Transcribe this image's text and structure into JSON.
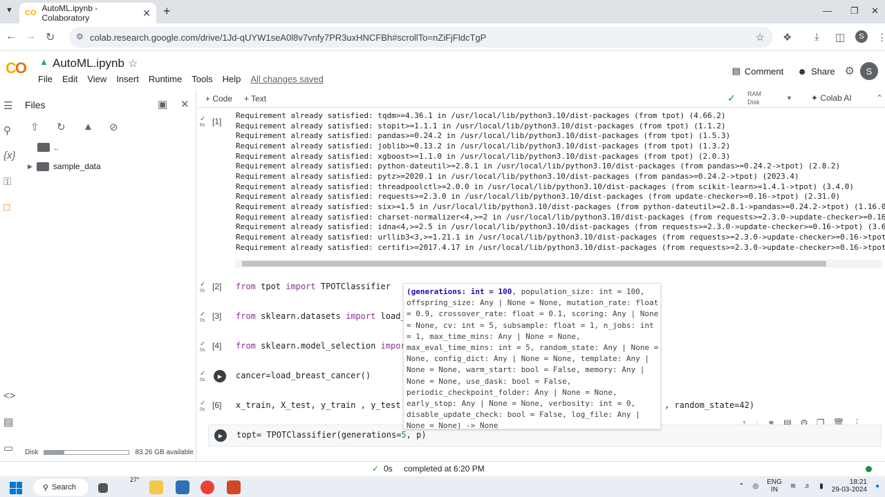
{
  "browser": {
    "tab_title": "AutoML.ipynb - Colaboratory",
    "url": "colab.research.google.com/drive/1Jd-qUYW1seA0l8v7vnfy7PR3uxHNCFBh#scrollTo=nZiFjFldcTgP",
    "profile_initial": "S"
  },
  "colab": {
    "notebook_title": "AutoML.ipynb",
    "menu": [
      "File",
      "Edit",
      "View",
      "Insert",
      "Runtime",
      "Tools",
      "Help"
    ],
    "saved_status": "All changes saved",
    "comment_label": "Comment",
    "share_label": "Share",
    "user_initial": "S"
  },
  "toolbar": {
    "add_code": "+ Code",
    "add_text": "+ Text",
    "ram_label": "RAM",
    "disk_label": "Disk",
    "colab_ai": "Colab AI"
  },
  "files_panel": {
    "title": "Files",
    "parent_dir": "..",
    "folder": "sample_data",
    "disk_label": "Disk",
    "disk_free": "83.26 GB available",
    "disk_used_fraction": 0.23
  },
  "cells": [
    {
      "number": "[1]",
      "time": "6s",
      "output": [
        "Requirement already satisfied: tqdm>=4.36.1 in /usr/local/lib/python3.10/dist-packages (from tpot) (4.66.2)",
        "Requirement already satisfied: stopit>=1.1.1 in /usr/local/lib/python3.10/dist-packages (from tpot) (1.1.2)",
        "Requirement already satisfied: pandas>=0.24.2 in /usr/local/lib/python3.10/dist-packages (from tpot) (1.5.3)",
        "Requirement already satisfied: joblib>=0.13.2 in /usr/local/lib/python3.10/dist-packages (from tpot) (1.3.2)",
        "Requirement already satisfied: xgboost>=1.1.0 in /usr/local/lib/python3.10/dist-packages (from tpot) (2.0.3)",
        "Requirement already satisfied: python-dateutil>=2.8.1 in /usr/local/lib/python3.10/dist-packages (from pandas>=0.24.2->tpot) (2.8.2)",
        "Requirement already satisfied: pytz>=2020.1 in /usr/local/lib/python3.10/dist-packages (from pandas>=0.24.2->tpot) (2023.4)",
        "Requirement already satisfied: threadpoolctl>=2.0.0 in /usr/local/lib/python3.10/dist-packages (from scikit-learn>=1.4.1->tpot) (3.4.0)",
        "Requirement already satisfied: requests>=2.3.0 in /usr/local/lib/python3.10/dist-packages (from update-checker>=0.16->tpot) (2.31.0)",
        "Requirement already satisfied: six>=1.5 in /usr/local/lib/python3.10/dist-packages (from python-dateutil>=2.8.1->pandas>=0.24.2->tpot) (1.16.0)",
        "Requirement already satisfied: charset-normalizer<4,>=2 in /usr/local/lib/python3.10/dist-packages (from requests>=2.3.0->update-checker>=0.16->",
        "Requirement already satisfied: idna<4,>=2.5 in /usr/local/lib/python3.10/dist-packages (from requests>=2.3.0->update-checker>=0.16->tpot) (3.6)",
        "Requirement already satisfied: urllib3<3,>=1.21.1 in /usr/local/lib/python3.10/dist-packages (from requests>=2.3.0->update-checker>=0.16->tpot)",
        "Requirement already satisfied: certifi>=2017.4.17 in /usr/local/lib/python3.10/dist-packages (from requests>=2.3.0->update-checker>=0.16->tpot)"
      ]
    },
    {
      "number": "[2]",
      "time": "0s",
      "kw1": "from",
      "mod": " tpot ",
      "kw2": "import",
      "name": " TPOTClassifier"
    },
    {
      "number": "[3]",
      "time": "0s",
      "kw1": "from",
      "mod": " sklearn.datasets ",
      "kw2": "import",
      "name": " load_bre"
    },
    {
      "number": "[4]",
      "time": "0s",
      "kw1": "from",
      "mod": " sklearn.model_selection ",
      "kw2": "import",
      "name": " t"
    },
    {
      "number": "",
      "time": "0s",
      "code": "cancer=load_breast_cancer()"
    },
    {
      "number": "[6]",
      "time": "0s",
      "code": "x_train, X_test, y_train , y_test = t",
      "tail": ", random_state=42)"
    },
    {
      "number": "",
      "time": "",
      "code_pre": "topt= TPOTClassifier(generations=",
      "code_num": "5",
      "code_post": ", p)"
    }
  ],
  "tooltip": {
    "signature_bold": "(generations: int = 100",
    "lines": [
      ", population_size: int = 100,",
      "offspring_size: Any | None = None, mutation_rate: float",
      "= 0.9, crossover_rate: float = 0.1, scoring: Any | None",
      "= None, cv: int = 5, subsample: float = 1, n_jobs: int",
      "= 1, max_time_mins: Any | None = None,",
      "max_eval_time_mins: int = 5, random_state: Any | None =",
      "None, config_dict: Any | None = None, template: Any |",
      "None = None, warm_start: bool = False, memory: Any |",
      "None = None, use_dask: bool = False,",
      "periodic_checkpoint_folder: Any | None = None,",
      "early_stop: Any | None = None, verbosity: int = 0,",
      "disable_update_check: bool = False, log_file: Any |",
      "None = None) -> None"
    ]
  },
  "status": {
    "time": "0s",
    "completed": "completed at 6:20 PM"
  },
  "taskbar": {
    "search": "Search",
    "weather": "27°",
    "lang": "ENG",
    "lang2": "IN",
    "time": "18:21",
    "date": "29-03-2024"
  }
}
